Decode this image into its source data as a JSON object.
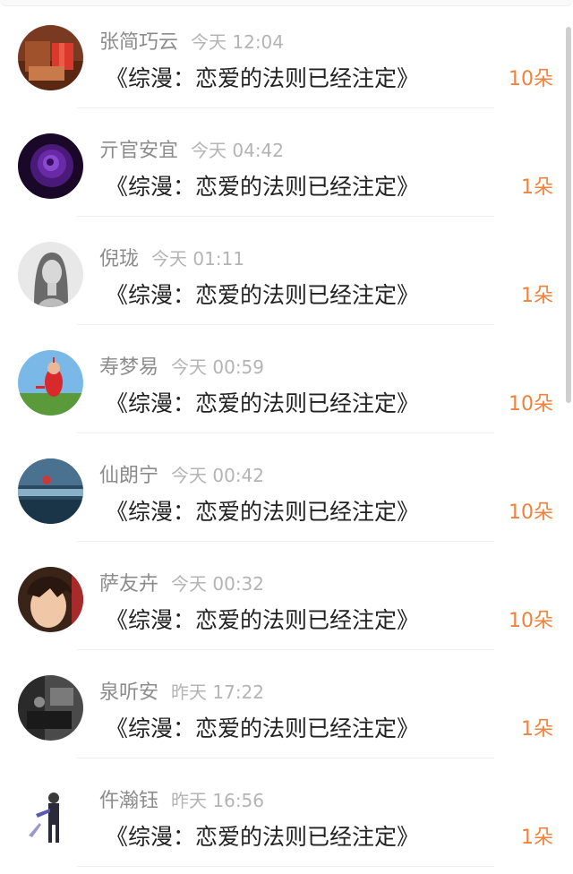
{
  "items": [
    {
      "name": "张简巧云",
      "time": "今天 12:04",
      "title": "《综漫：恋爱的法则已经注定》",
      "count": "10朵",
      "avatar_icon": "gift-box-avatar"
    },
    {
      "name": "亓官安宜",
      "time": "今天 04:42",
      "title": "《综漫：恋爱的法则已经注定》",
      "count": "1朵",
      "avatar_icon": "purple-rose-avatar"
    },
    {
      "name": "倪珑",
      "time": "今天 01:11",
      "title": "《综漫：恋爱的法则已经注定》",
      "count": "1朵",
      "avatar_icon": "woman-portrait-avatar"
    },
    {
      "name": "寿梦易",
      "time": "今天 00:59",
      "title": "《综漫：恋爱的法则已经注定》",
      "count": "10朵",
      "avatar_icon": "red-toy-avatar"
    },
    {
      "name": "仙朗宁",
      "time": "今天 00:42",
      "title": "《综漫：恋爱的法则已经注定》",
      "count": "10朵",
      "avatar_icon": "blue-scenery-avatar"
    },
    {
      "name": "萨友卉",
      "time": "今天 00:32",
      "title": "《综漫：恋爱的法则已经注定》",
      "count": "10朵",
      "avatar_icon": "anime-face-avatar"
    },
    {
      "name": "泉听安",
      "time": "昨天 17:22",
      "title": "《综漫：恋爱的法则已经注定》",
      "count": "1朵",
      "avatar_icon": "dark-room-avatar"
    },
    {
      "name": "仵瀚钰",
      "time": "昨天 16:56",
      "title": "《综漫：恋爱的法则已经注定》",
      "count": "1朵",
      "avatar_icon": "figure-avatar"
    }
  ],
  "colors": {
    "count": "#f0823c",
    "name": "#8c8c8c",
    "time": "#b4b4b4",
    "title": "#222222"
  }
}
